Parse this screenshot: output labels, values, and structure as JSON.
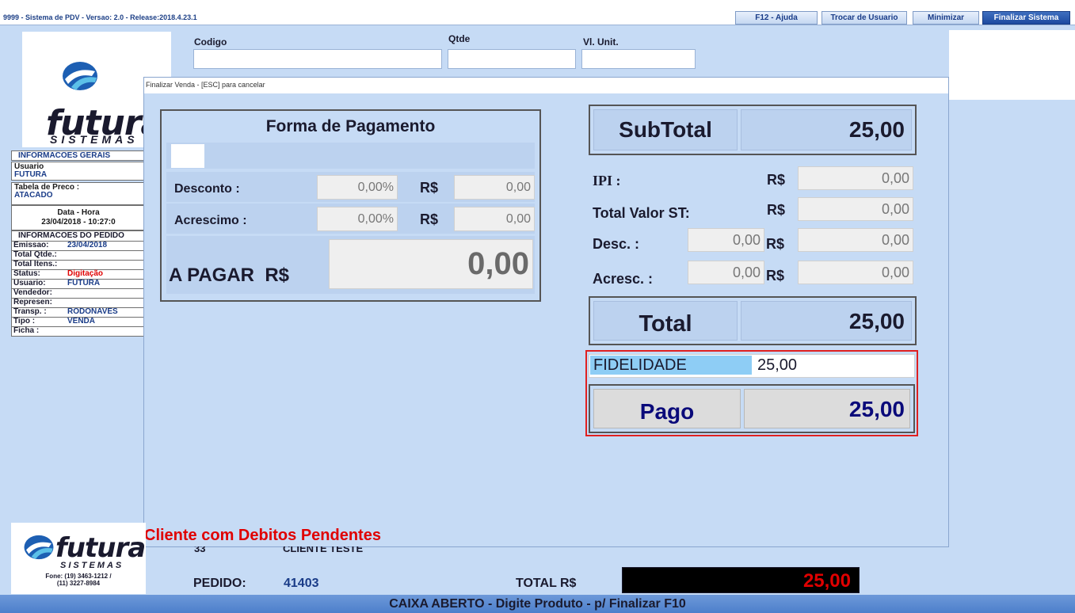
{
  "window": {
    "title": "9999 - Sistema de PDV - Versao: 2.0 - Release:2018.4.23.1",
    "buttons": [
      "F12 - Ajuda",
      "Trocar de Usuario",
      "Minimizar",
      "Finalizar Sistema"
    ]
  },
  "header": {
    "codigo_label": "Codigo",
    "qtde_label": "Qtde",
    "vl_unit_label": "Vl. Unit.",
    "codigo_value": "",
    "qtde_value": "",
    "vl_unit_value": ""
  },
  "brand": {
    "name": "futura",
    "sub": "SISTEMAS",
    "phone_line1": "Fone: (19) 3463-1212 /",
    "phone_line2": "(11) 3227-8984"
  },
  "info_gerais": {
    "title": "INFORMACOES GERAIS",
    "usuario_label": "Usuario",
    "usuario_value": "FUTURA",
    "tabela_label": "Tabela de Preco :",
    "tabela_value": "ATACADO",
    "datahora_label": "Data - Hora",
    "datahora_value": "23/04/2018 - 10:27:0"
  },
  "info_pedido": {
    "title": "INFORMACOES DO PEDIDO",
    "rows": [
      {
        "k": "Emissao:",
        "v": "23/04/2018",
        "color": "#1a3c88"
      },
      {
        "k": "Total Qtde.:",
        "v": "",
        "color": "#1a3c88"
      },
      {
        "k": "Total Itens.:",
        "v": "",
        "color": "#1a3c88"
      },
      {
        "k": "Status:",
        "v": "Digitação",
        "color": "#e00000"
      },
      {
        "k": "Usuario:",
        "v": "FUTURA",
        "color": "#1a3c88"
      },
      {
        "k": "Vendedor:",
        "v": "",
        "color": "#1a3c88"
      },
      {
        "k": "Represen:",
        "v": "",
        "color": "#1a3c88"
      },
      {
        "k": "Transp. :",
        "v": "RODONAVES",
        "color": "#1a3c88"
      },
      {
        "k": "Tipo :",
        "v": "VENDA",
        "color": "#1a3c88"
      },
      {
        "k": "Ficha :",
        "v": "",
        "color": "#1a3c88"
      }
    ]
  },
  "modal": {
    "title": "Finalizar Venda - [ESC] para cancelar",
    "forma": {
      "title": "Forma de Pagamento",
      "desconto_label": "Desconto :",
      "desconto_pct": "0,00%",
      "desconto_currency": "R$",
      "desconto_val": "0,00",
      "acrescimo_label": "Acrescimo :",
      "acrescimo_pct": "0,00%",
      "acrescimo_currency": "R$",
      "acrescimo_val": "0,00",
      "apagar_label": "A PAGAR  R$",
      "apagar_val": "0,00"
    },
    "totals": {
      "subtotal_label": "SubTotal",
      "subtotal_val": "25,00",
      "ipi_label": "IPI :",
      "ipi_currency": "R$",
      "ipi_val": "0,00",
      "st_label": "Total Valor ST:",
      "st_currency": "R$",
      "st_val": "0,00",
      "desc_label": "Desc. :",
      "desc_pct": "0,00",
      "desc_currency": "R$",
      "desc_val": "0,00",
      "acresc_label": "Acresc. :",
      "acresc_pct": "0,00",
      "acresc_currency": "R$",
      "acresc_val": "0,00",
      "total_label": "Total",
      "total_val": "25,00",
      "fidelidade_label": "FIDELIDADE",
      "fidelidade_val": "25,00",
      "pago_label": "Pago",
      "pago_val": "25,00"
    },
    "status_msg": "Cliente com Debitos Pendentes"
  },
  "bottom": {
    "cliente_code": "33",
    "cliente_name": "CLIENTE TESTE",
    "pedido_label": "PEDIDO:",
    "pedido_val": "41403",
    "total_label": "TOTAL R$",
    "total_val": "25,00",
    "status": "CAIXA ABERTO - Digite Produto - p/ Finalizar F10"
  },
  "colors": {
    "background": "#c6dbf5",
    "accent_blue": "#1a3c88",
    "pago_blue": "#0a0a7a",
    "alert_red": "#e00000",
    "fidelidade_bg": "#8ecdf5",
    "highlight_border": "#e02020"
  }
}
